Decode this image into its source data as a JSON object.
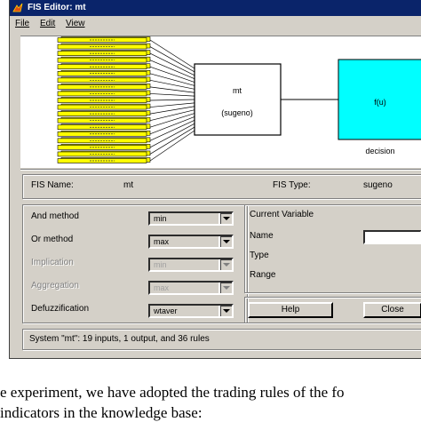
{
  "window": {
    "title": "FIS Editor: mt",
    "menu": [
      "File",
      "Edit",
      "View"
    ]
  },
  "diagram": {
    "system_name": "mt",
    "system_type_label": "(sugeno)",
    "output_function_label": "f(u)",
    "output_name": "decision",
    "input_count": 19
  },
  "info_bar": {
    "fis_name_label": "FIS Name:",
    "fis_name_value": "mt",
    "fis_type_label": "FIS Type:",
    "fis_type_value": "sugeno"
  },
  "methods": [
    {
      "label": "And method",
      "value": "min",
      "enabled": true
    },
    {
      "label": "Or method",
      "value": "max",
      "enabled": true
    },
    {
      "label": "Implication",
      "value": "min",
      "enabled": false
    },
    {
      "label": "Aggregation",
      "value": "max",
      "enabled": false
    },
    {
      "label": "Defuzzification",
      "value": "wtaver",
      "enabled": true
    }
  ],
  "current_variable": {
    "heading": "Current Variable",
    "name_label": "Name",
    "type_label": "Type",
    "range_label": "Range"
  },
  "buttons": {
    "help": "Help",
    "close": "Close"
  },
  "status": "System \"mt\": 19 inputs, 1 output, and 36 rules",
  "caption": {
    "line1": "e experiment, we have adopted the trading rules of the fo",
    "line2": "indicators in the knowledge base:"
  },
  "colors": {
    "input_box": "#ffff00",
    "output_box": "#00ffff",
    "title_bar": "#0a246a",
    "face": "#d4d0c8"
  }
}
